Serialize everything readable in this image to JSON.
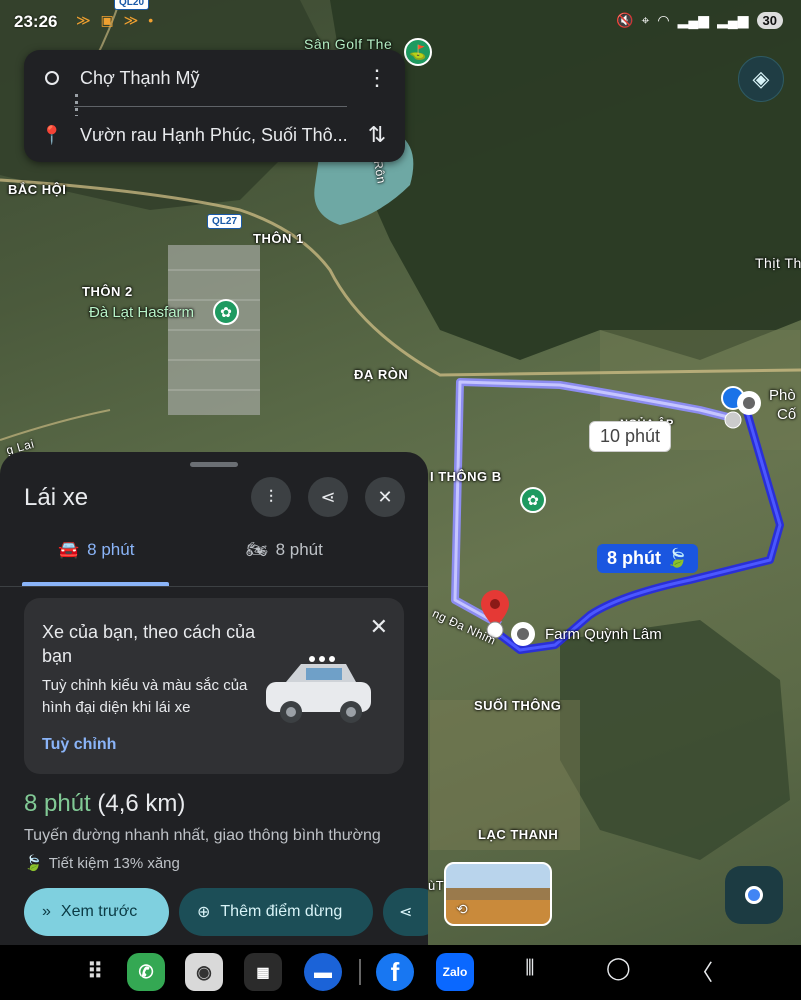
{
  "status_bar": {
    "time": "23:26",
    "left_icons": "≫ ▣ ≫ •",
    "right_icons": [
      "mute-icon",
      "location-icon",
      "wifi-icon",
      "signal-icon",
      "signal-icon"
    ],
    "battery": "30"
  },
  "search": {
    "origin": "Chợ Thạnh Mỹ",
    "destination": "Vườn rau Hạnh Phúc, Suối Thô..."
  },
  "map": {
    "labels": {
      "golf": "Sân Golf The",
      "bac_hoi": "BẮC HỘI",
      "thon1": "THÔN 1",
      "thon2": "THÔN 2",
      "hasfarm": "Đà Lạt Hasfarm",
      "da_ron": "ĐẠ RÒN",
      "thon_b": "I THÔNG B",
      "suoi_thong": "SUỐI THÔNG",
      "lac_thanh": "LẠC THANH",
      "farm": "Farm Quỳnh Lâm",
      "thit": "Thịt Th",
      "phon": "Phò",
      "co": "Cố",
      "ng_lai": "g Lai",
      "nhin": "ng Đa Nhim",
      "ron": "Rôn",
      "tu": "ùT",
      "ngap": "NGỦA ẬP"
    },
    "road_badges": {
      "ql20": "QL20",
      "ql27": "QL27"
    },
    "route_alt_bubble": "10 phút",
    "route_main_bubble": "8 phút",
    "colors": {
      "route_main": "#2a2fd6",
      "route_alt": "#8c8cf0",
      "pin": "#e53935"
    }
  },
  "sheet": {
    "title": "Lái xe",
    "tabs": [
      {
        "icon": "car-icon",
        "label": "8 phút"
      },
      {
        "icon": "motorbike-icon",
        "label": "8 phút"
      }
    ],
    "promo": {
      "title": "Xe của bạn, theo cách của bạn",
      "body": "Tuỳ chỉnh kiểu và màu sắc của hình đại diện khi lái xe",
      "link": "Tuỳ chỉnh"
    },
    "eta_time": "8 phút",
    "eta_distance": "(4,6 km)",
    "route_desc": "Tuyến đường nhanh nhất, giao thông bình thường",
    "fuel_saving": "Tiết kiệm 13% xăng",
    "buttons": {
      "preview": "Xem trước",
      "add_stop": "Thêm điểm dừng"
    }
  },
  "nav_apps": [
    "apps-grid-icon",
    "phone-icon",
    "camera-icon",
    "app-folder-icon",
    "messages-icon",
    "facebook-icon",
    "zalo-icon"
  ],
  "nav_app_text": {
    "facebook": "f",
    "zalo": "Zalo"
  }
}
